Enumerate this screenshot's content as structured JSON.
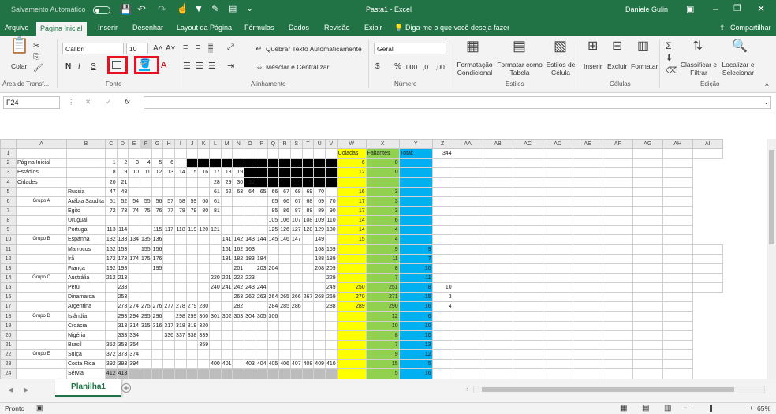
{
  "title_bar": {
    "autosave": "Salvamento Automático",
    "doc_title": "Pasta1 - Excel",
    "user": "Daniele Gulin"
  },
  "tabs": [
    "Arquivo",
    "Página Inicial",
    "Inserir",
    "Desenhar",
    "Layout da Página",
    "Fórmulas",
    "Dados",
    "Revisão",
    "Exibir"
  ],
  "tell_me": "Diga-me o que você deseja fazer",
  "share": "Compartilhar",
  "ribbon": {
    "paste": "Colar",
    "font_name": "Calibri",
    "font_size": "10",
    "bold": "N",
    "italic": "I",
    "underline": "S",
    "wrap_text": "Quebrar Texto Automaticamente",
    "merge": "Mesclar e Centralizar",
    "number_format": "Geral",
    "percent": "%",
    "thousands": "000",
    "cond_format": "Formatação Condicional",
    "format_table": "Formatar como Tabela",
    "cell_styles": "Estilos de Célula",
    "insert": "Inserir",
    "delete": "Excluir",
    "format": "Formatar",
    "sort_filter": "Classificar e Filtrar",
    "find_select": "Localizar e Selecionar",
    "groups": {
      "clipboard": "Área de Transf...",
      "font": "Fonte",
      "alignment": "Alinhamento",
      "number": "Número",
      "styles": "Estilos",
      "cells": "Células",
      "editing": "Edição"
    }
  },
  "name_box": "F24",
  "formula_icons": {
    "cancel": "✕",
    "enter": "✓",
    "fx": "fx"
  },
  "colors": {
    "excel_green": "#217346",
    "highlight_red": "#e81123",
    "yellow": "#ffff00",
    "green": "#92d050",
    "blue": "#00b0f0",
    "black": "#000000"
  },
  "grid": {
    "columns": [
      "A",
      "B",
      "C",
      "D",
      "E",
      "F",
      "G",
      "H",
      "I",
      "J",
      "K",
      "L",
      "M",
      "N",
      "O",
      "P",
      "Q",
      "R",
      "S",
      "T",
      "U",
      "V",
      "W",
      "X",
      "Y",
      "Z",
      "AA",
      "AB",
      "AC",
      "AD",
      "AE",
      "AF",
      "AG",
      "AH",
      "AI"
    ],
    "rows": [
      [
        "1",
        "",
        "",
        "",
        "",
        "",
        "",
        "",
        "",
        "",
        "",
        "",
        "",
        "",
        "",
        "",
        "",
        "",
        "",
        "",
        "",
        "",
        "",
        "Coladas",
        "Faltantes",
        "Total:",
        "344",
        "",
        "",
        "",
        "",
        "",
        "",
        "",
        "",
        ""
      ],
      [
        "2",
        "Página Inicial",
        "",
        "1",
        "2",
        "3",
        "4",
        "5",
        "6",
        "",
        "",
        "",
        "",
        "",
        "",
        "",
        "",
        "",
        "",
        "",
        "",
        "",
        "",
        "6",
        "0",
        "",
        "",
        "",
        "",
        "",
        "",
        "",
        "",
        "",
        ""
      ],
      [
        "3",
        "Estádios",
        "",
        "8",
        "9",
        "10",
        "11",
        "12",
        "13",
        "14",
        "15",
        "16",
        "17",
        "18",
        "19",
        "",
        "",
        "",
        "",
        "",
        "",
        "",
        "",
        "12",
        "0",
        "",
        "",
        "",
        "",
        "",
        "",
        "",
        "",
        "",
        ""
      ],
      [
        "4",
        "Cidades",
        "",
        "20",
        "21",
        "",
        "",
        "",
        "",
        "",
        "",
        "",
        "28",
        "29",
        "30",
        "31",
        "",
        "",
        "",
        "",
        "",
        "",
        "",
        "",
        "",
        "",
        "",
        "",
        "",
        "",
        "",
        "",
        "",
        "",
        ""
      ],
      [
        "5",
        "",
        "Russia",
        "47",
        "48",
        "",
        "",
        "",
        "",
        "",
        "",
        "",
        "61",
        "62",
        "63",
        "64",
        "65",
        "66",
        "67",
        "68",
        "69",
        "70",
        "",
        "16",
        "3",
        "",
        "",
        "",
        "",
        "",
        "",
        "",
        "",
        "",
        ""
      ],
      [
        "6",
        "Grupo A",
        "Arábia Saudita",
        "51",
        "52",
        "54",
        "55",
        "56",
        "57",
        "58",
        "59",
        "60",
        "61",
        "",
        "",
        "",
        "",
        "65",
        "66",
        "67",
        "68",
        "69",
        "70",
        "17",
        "3",
        "",
        "",
        "",
        "",
        "",
        "",
        "",
        "",
        "",
        ""
      ],
      [
        "7",
        "",
        "Egito",
        "72",
        "73",
        "74",
        "75",
        "76",
        "77",
        "78",
        "79",
        "80",
        "81",
        "",
        "",
        "",
        "",
        "85",
        "86",
        "87",
        "88",
        "89",
        "90",
        "17",
        "3",
        "",
        "",
        "",
        "",
        "",
        "",
        "",
        "",
        "",
        ""
      ],
      [
        "8",
        "",
        "Uruguai",
        "",
        "",
        "",
        "",
        "",
        "",
        "",
        "",
        "",
        "",
        "",
        "",
        "",
        "",
        "105",
        "106",
        "107",
        "108",
        "109",
        "110",
        "14",
        "6",
        "",
        "",
        "",
        "",
        "",
        "",
        "",
        "",
        "",
        ""
      ],
      [
        "9",
        "",
        "Portugal",
        "113",
        "114",
        "",
        "",
        "115",
        "117",
        "118",
        "119",
        "120",
        "121",
        "",
        "",
        "",
        "",
        "125",
        "126",
        "127",
        "128",
        "129",
        "130",
        "14",
        "4",
        "",
        "",
        "",
        "",
        "",
        "",
        "",
        "",
        "",
        ""
      ],
      [
        "10",
        "Grupo B",
        "Espanha",
        "132",
        "133",
        "134",
        "135",
        "136",
        "",
        "",
        "",
        "",
        "",
        "141",
        "142",
        "143",
        "144",
        "145",
        "146",
        "147",
        "",
        "149",
        "",
        "15",
        "4",
        "",
        "",
        "",
        "",
        "",
        "",
        "",
        "",
        "",
        ""
      ],
      [
        "11",
        "",
        "Marrocos",
        "152",
        "153",
        "",
        "155",
        "156",
        "",
        "",
        "",
        "",
        "",
        "161",
        "162",
        "163",
        "",
        "",
        "",
        "",
        "",
        "168",
        "169",
        "",
        "9",
        "9",
        "",
        "",
        "",
        "",
        "",
        "",
        "",
        "",
        "",
        ""
      ],
      [
        "12",
        "",
        "Irã",
        "172",
        "173",
        "174",
        "175",
        "176",
        "",
        "",
        "",
        "",
        "",
        "181",
        "182",
        "183",
        "184",
        "",
        "",
        "",
        "",
        "188",
        "189",
        "",
        "11",
        "7",
        "",
        "",
        "",
        "",
        "",
        "",
        "",
        "",
        "",
        ""
      ],
      [
        "13",
        "",
        "França",
        "192",
        "193",
        "",
        "",
        "195",
        "",
        "",
        "",
        "",
        "",
        "",
        "201",
        "",
        "203",
        "204",
        "",
        "",
        "",
        "208",
        "209",
        "",
        "8",
        "10",
        "",
        "",
        "",
        "",
        "",
        "",
        "",
        "",
        "",
        ""
      ],
      [
        "14",
        "Grupo C",
        "Austrália",
        "212",
        "213",
        "",
        "",
        "",
        "",
        "",
        "",
        "",
        "220",
        "221",
        "222",
        "223",
        "",
        "",
        "",
        "",
        "",
        "",
        "229",
        "",
        "7",
        "11",
        "",
        "",
        "",
        "",
        "",
        "",
        "",
        "",
        "",
        ""
      ],
      [
        "15",
        "",
        "Peru",
        "",
        "233",
        "",
        "",
        "",
        "",
        "",
        "",
        "",
        "240",
        "241",
        "242",
        "243",
        "244",
        "",
        "",
        "",
        "",
        "",
        "249",
        "250",
        "251",
        "8",
        "10",
        "",
        "",
        "",
        "",
        "",
        "",
        "",
        "",
        ""
      ],
      [
        "16",
        "",
        "Dinamarca",
        "",
        "253",
        "",
        "",
        "",
        "",
        "",
        "",
        "",
        "",
        "",
        "263",
        "262",
        "263",
        "264",
        "265",
        "266",
        "267",
        "268",
        "269",
        "270",
        "271",
        "15",
        "3",
        "",
        "",
        "",
        "",
        "",
        "",
        "",
        ""
      ],
      [
        "17",
        "",
        "Argentina",
        "",
        "273",
        "274",
        "275",
        "276",
        "277",
        "278",
        "279",
        "280",
        "",
        "",
        "282",
        "",
        "",
        "284",
        "285",
        "286",
        "",
        "",
        "288",
        "289",
        "290",
        "16",
        "4",
        "",
        "",
        "",
        "",
        "",
        "",
        "",
        ""
      ],
      [
        "18",
        "Grupo D",
        "Islândia",
        "",
        "293",
        "294",
        "295",
        "296",
        "",
        "298",
        "299",
        "300",
        "301",
        "302",
        "303",
        "304",
        "305",
        "306",
        "",
        "",
        "",
        "",
        "",
        "",
        "12",
        "6",
        "",
        "",
        "",
        "",
        "",
        "",
        "",
        "",
        ""
      ],
      [
        "19",
        "",
        "Croácia",
        "",
        "313",
        "314",
        "315",
        "316",
        "317",
        "318",
        "319",
        "320",
        "",
        "",
        "",
        "",
        "",
        "",
        "",
        "",
        "",
        "",
        "",
        "",
        "10",
        "10",
        "",
        "",
        "",
        "",
        "",
        "",
        "",
        "",
        ""
      ],
      [
        "20",
        "",
        "Nigéria",
        "",
        "333",
        "334",
        "",
        "",
        "336",
        "337",
        "338",
        "339",
        "",
        "",
        "",
        "",
        "",
        "",
        "",
        "",
        "",
        "",
        "",
        "",
        "8",
        "10",
        "",
        "",
        "",
        "",
        "",
        "",
        "",
        "",
        ""
      ],
      [
        "21",
        "",
        "Brasil",
        "352",
        "353",
        "354",
        "",
        "",
        "",
        "",
        "",
        "359",
        "",
        "",
        "",
        "",
        "",
        "",
        "",
        "",
        "",
        "",
        "",
        "",
        "7",
        "13",
        "",
        "",
        "",
        "",
        "",
        "",
        "",
        "",
        ""
      ],
      [
        "22",
        "Grupo E",
        "Suíça",
        "372",
        "373",
        "374",
        "",
        "",
        "",
        "",
        "",
        "",
        "",
        "",
        "",
        "",
        "",
        "",
        "",
        "",
        "",
        "",
        "",
        "",
        "9",
        "12",
        "",
        "",
        "",
        "",
        "",
        "",
        "",
        "",
        ""
      ],
      [
        "23",
        "",
        "Costa Rica",
        "392",
        "393",
        "394",
        "",
        "",
        "",
        "",
        "",
        "",
        "400",
        "401",
        "",
        "403",
        "404",
        "405",
        "406",
        "407",
        "408",
        "409",
        "410",
        "",
        "15",
        "5",
        "",
        "",
        "",
        "",
        "",
        "",
        "",
        "",
        ""
      ],
      [
        "24",
        "",
        "Sérvia",
        "412",
        "413",
        "",
        "",
        "",
        "",
        "",
        "",
        "",
        "",
        "",
        "",
        "",
        "",
        "",
        "",
        "",
        "",
        "",
        "",
        "",
        "5",
        "16",
        "",
        "",
        "",
        "",
        "",
        "",
        "",
        "",
        ""
      ]
    ]
  },
  "sheet_tab": "Planilha1",
  "status": {
    "ready": "Pronto",
    "zoom": "65%"
  }
}
